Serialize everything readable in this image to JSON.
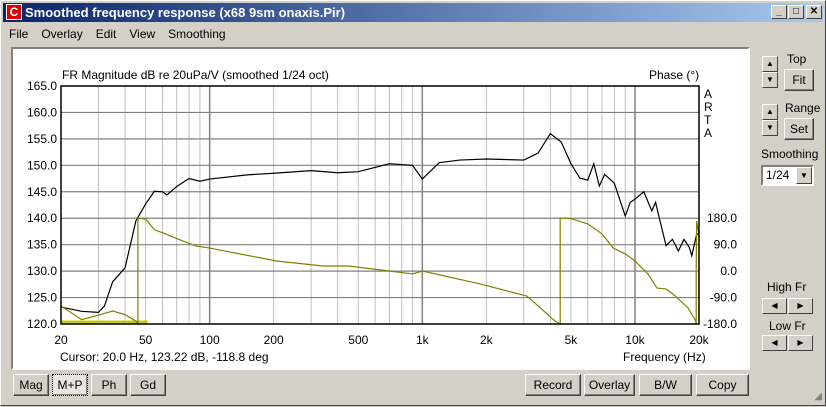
{
  "window": {
    "title": "Smoothed frequency response (x68 9sm  onaxis.Pir)",
    "icon": "C",
    "minimize": "_",
    "maximize": "□",
    "close": "✕"
  },
  "menu": [
    "File",
    "Overlay",
    "Edit",
    "View",
    "Smoothing"
  ],
  "plot": {
    "mag_title": "FR Magnitude dB re 20uPa/V (smoothed 1/24 oct)",
    "phase_title": "Phase (°)",
    "brand": [
      "A",
      "R",
      "T",
      "A"
    ],
    "xlabel": "Frequency (Hz)",
    "cursor": "Cursor: 20.0 Hz, 123.22 dB, -118.8 deg"
  },
  "right": {
    "top_label": "Top",
    "fit": "Fit",
    "range_label": "Range",
    "set": "Set",
    "smoothing_label": "Smoothing",
    "smoothing_value": "1/24",
    "highfr_label": "High Fr",
    "lowfr_label": "Low Fr"
  },
  "bottom_left": [
    "Mag",
    "M+P",
    "Ph",
    "Gd"
  ],
  "bottom_right": [
    "Record",
    "Overlay",
    "B/W",
    "Copy"
  ],
  "colors": {
    "magnitude": "#000000",
    "phase": "#808000",
    "marker": "#c8c800"
  },
  "chart_data": {
    "type": "line",
    "title": "FR Magnitude dB re 20uPa/V (smoothed 1/24 oct)",
    "xlabel": "Frequency (Hz)",
    "xscale": "log",
    "xlim": [
      20,
      20000
    ],
    "ylabel": "dB",
    "ylim": [
      120,
      165
    ],
    "y2label": "Phase (°)",
    "y2lim": [
      -180,
      180
    ],
    "x_ticks": [
      "20",
      "50",
      "100",
      "200",
      "500",
      "1k",
      "2k",
      "5k",
      "10k",
      "20k"
    ],
    "x_tick_values": [
      20,
      50,
      100,
      200,
      500,
      1000,
      2000,
      5000,
      10000,
      20000
    ],
    "y_ticks": [
      "165.0",
      "160.0",
      "155.0",
      "150.0",
      "145.0",
      "140.0",
      "135.0",
      "130.0",
      "125.0",
      "120.0"
    ],
    "y2_ticks": [
      "180.0",
      "90.0",
      "0.0",
      "-90.0",
      "-180.0"
    ],
    "series": [
      {
        "name": "Magnitude",
        "axis": "y",
        "points": [
          [
            20,
            123.2
          ],
          [
            25,
            122.4
          ],
          [
            30,
            122.2
          ],
          [
            32,
            123.4
          ],
          [
            35,
            128
          ],
          [
            40,
            130.6
          ],
          [
            45,
            139.5
          ],
          [
            50,
            142.7
          ],
          [
            55,
            145.1
          ],
          [
            60,
            145
          ],
          [
            63,
            144.4
          ],
          [
            70,
            146
          ],
          [
            80,
            147.5
          ],
          [
            90,
            147
          ],
          [
            100,
            147.4
          ],
          [
            150,
            148.2
          ],
          [
            200,
            148.5
          ],
          [
            300,
            149
          ],
          [
            400,
            148.6
          ],
          [
            500,
            148.8
          ],
          [
            700,
            150.3
          ],
          [
            900,
            150
          ],
          [
            1000,
            147.4
          ],
          [
            1200,
            150.5
          ],
          [
            1500,
            151
          ],
          [
            2000,
            151.2
          ],
          [
            3000,
            151
          ],
          [
            3500,
            152.3
          ],
          [
            4000,
            156
          ],
          [
            4500,
            154.4
          ],
          [
            5000,
            150.3
          ],
          [
            5500,
            147.6
          ],
          [
            6000,
            147.2
          ],
          [
            6400,
            150.3
          ],
          [
            6800,
            146.1
          ],
          [
            7200,
            148.3
          ],
          [
            8000,
            146.6
          ],
          [
            9000,
            140.4
          ],
          [
            9500,
            143
          ],
          [
            10000,
            143.6
          ],
          [
            11000,
            145
          ],
          [
            12000,
            141.4
          ],
          [
            12500,
            143
          ],
          [
            13000,
            140.1
          ],
          [
            14000,
            134.8
          ],
          [
            15000,
            136
          ],
          [
            16000,
            133.8
          ],
          [
            17000,
            136
          ],
          [
            18000,
            134.5
          ],
          [
            18500,
            132.9
          ],
          [
            19500,
            137
          ],
          [
            20000,
            137
          ]
        ]
      },
      {
        "name": "Phase",
        "axis": "y2",
        "segments": [
          [
            [
              20,
              -118.8
            ],
            [
              25,
              -165
            ],
            [
              30,
              -150
            ],
            [
              35,
              -136
            ],
            [
              40,
              -148
            ],
            [
              45,
              -170
            ],
            [
              46,
              -180
            ]
          ],
          [
            [
              46,
              180
            ],
            [
              50,
              176
            ],
            [
              55,
              140
            ],
            [
              62,
              126
            ],
            [
              69,
              112
            ],
            [
              86,
              85
            ],
            [
              100,
              78
            ],
            [
              206,
              34
            ],
            [
              342,
              17
            ],
            [
              450,
              17
            ],
            [
              700,
              0
            ],
            [
              900,
              -10
            ],
            [
              1000,
              0
            ],
            [
              1870,
              -44
            ],
            [
              3100,
              -85
            ],
            [
              3600,
              -126
            ],
            [
              4200,
              -170
            ],
            [
              4450,
              -180
            ]
          ],
          [
            [
              4450,
              180
            ],
            [
              5000,
              178
            ],
            [
              6000,
              160
            ],
            [
              7000,
              126
            ],
            [
              7900,
              78
            ],
            [
              9000,
              58
            ],
            [
              10000,
              34
            ],
            [
              11500,
              -10
            ],
            [
              12700,
              -58
            ],
            [
              14000,
              -61
            ],
            [
              15100,
              -78
            ],
            [
              17800,
              -126
            ],
            [
              19300,
              -170
            ],
            [
              19400,
              -180
            ]
          ],
          [
            [
              19400,
              0
            ],
            [
              19500,
              170
            ],
            [
              20000,
              120
            ]
          ]
        ]
      }
    ],
    "marker": {
      "from": 20,
      "to": 51,
      "value": 120
    }
  }
}
